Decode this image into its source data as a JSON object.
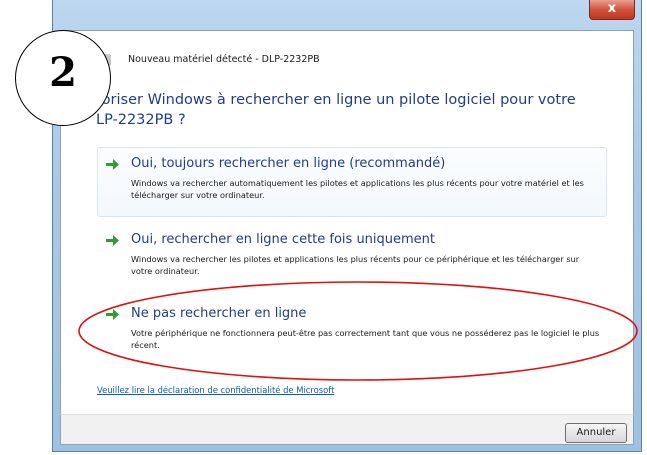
{
  "window": {
    "title": "Nouveau matériel détecté - DLP-2232PB",
    "close_label": "x"
  },
  "instruction": "…toriser Windows à rechercher en ligne un pilote logiciel pour votre …LP-2232PB ?",
  "instruction_lines": [
    "toriser Windows à rechercher en ligne un pilote logiciel pour votre",
    "LP-2232PB ?"
  ],
  "options": [
    {
      "heading": "Oui, toujours rechercher en ligne (recommandé)",
      "description": "Windows va rechercher automatiquement les pilotes et applications les plus récents pour votre matériel et les télécharger sur votre ordinateur."
    },
    {
      "heading": "Oui, rechercher en ligne cette fois uniquement",
      "description": "Windows va rechercher les pilotes et applications les plus récents pour ce périphérique et les télécharger sur votre ordinateur."
    },
    {
      "heading": "Ne pas rechercher en ligne",
      "description": "Votre périphérique ne fonctionnera peut-être pas correctement tant que vous ne posséderez pas le logiciel le plus récent."
    }
  ],
  "privacy_link": "Veuillez lire la déclaration de confidentialité de Microsoft",
  "cancel_button": "Annuler",
  "step_badge": "2",
  "colors": {
    "heading_blue": "#1f3d8a",
    "arrow_green": "#2e9e2e",
    "highlight_red": "#e01010",
    "link_blue": "#0e5bb8"
  }
}
